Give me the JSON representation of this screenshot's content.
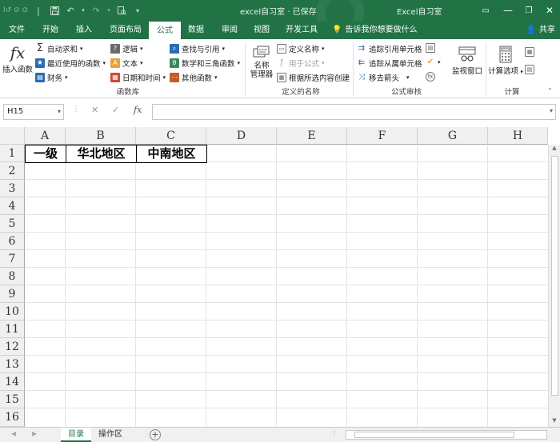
{
  "titlebar": {
    "qat_faded": "Ⅰ↺ ⊙ ⊙",
    "doc_title": "excel自习室 · 已保存",
    "app_title": "Excel自习室",
    "min": "—",
    "restore": "❐",
    "close": "✕"
  },
  "tabs": [
    {
      "label": "文件"
    },
    {
      "label": "开始"
    },
    {
      "label": "插入"
    },
    {
      "label": "页面布局"
    },
    {
      "label": "公式"
    },
    {
      "label": "数据"
    },
    {
      "label": "审阅"
    },
    {
      "label": "视图"
    },
    {
      "label": "开发工具"
    }
  ],
  "tellme": "告诉我你想要做什么",
  "share": "共享",
  "ribbon": {
    "insert_function": "插入函数",
    "autosum": "自动求和",
    "recent": "最近使用的函数",
    "financial": "财务",
    "logical": "逻辑",
    "text": "文本",
    "datetime": "日期和时间",
    "lookup": "查找与引用",
    "math": "数学和三角函数",
    "other": "其他函数",
    "group_library": "函数库",
    "name_manager": "名称\n管理器",
    "define_name": "定义名称",
    "use_in_formula": "用于公式",
    "create_from_sel": "根据所选内容创建",
    "group_names": "定义的名称",
    "trace_precedents": "追踪引用单元格",
    "trace_dependents": "追踪从属单元格",
    "remove_arrows": "移去箭头",
    "group_audit": "公式审核",
    "watch_window": "监视窗口",
    "calc_options": "计算选项",
    "group_calc": "计算"
  },
  "formula_bar": {
    "name_box": "H15",
    "cancel": "✕",
    "enter": "✓",
    "fx": "fx",
    "value": ""
  },
  "grid": {
    "columns": [
      "A",
      "B",
      "C",
      "D",
      "E",
      "F",
      "G",
      "H"
    ],
    "rows": [
      "1",
      "2",
      "3",
      "4",
      "5",
      "6",
      "7",
      "8",
      "9",
      "10",
      "11",
      "12",
      "13",
      "14",
      "15",
      "16"
    ],
    "cells": {
      "A1": "一级",
      "B1": "华北地区",
      "C1": "中南地区"
    }
  },
  "sheets": [
    {
      "label": "目录",
      "active": true
    },
    {
      "label": "操作区",
      "active": false
    }
  ],
  "colors": {
    "accent": "#217346"
  }
}
